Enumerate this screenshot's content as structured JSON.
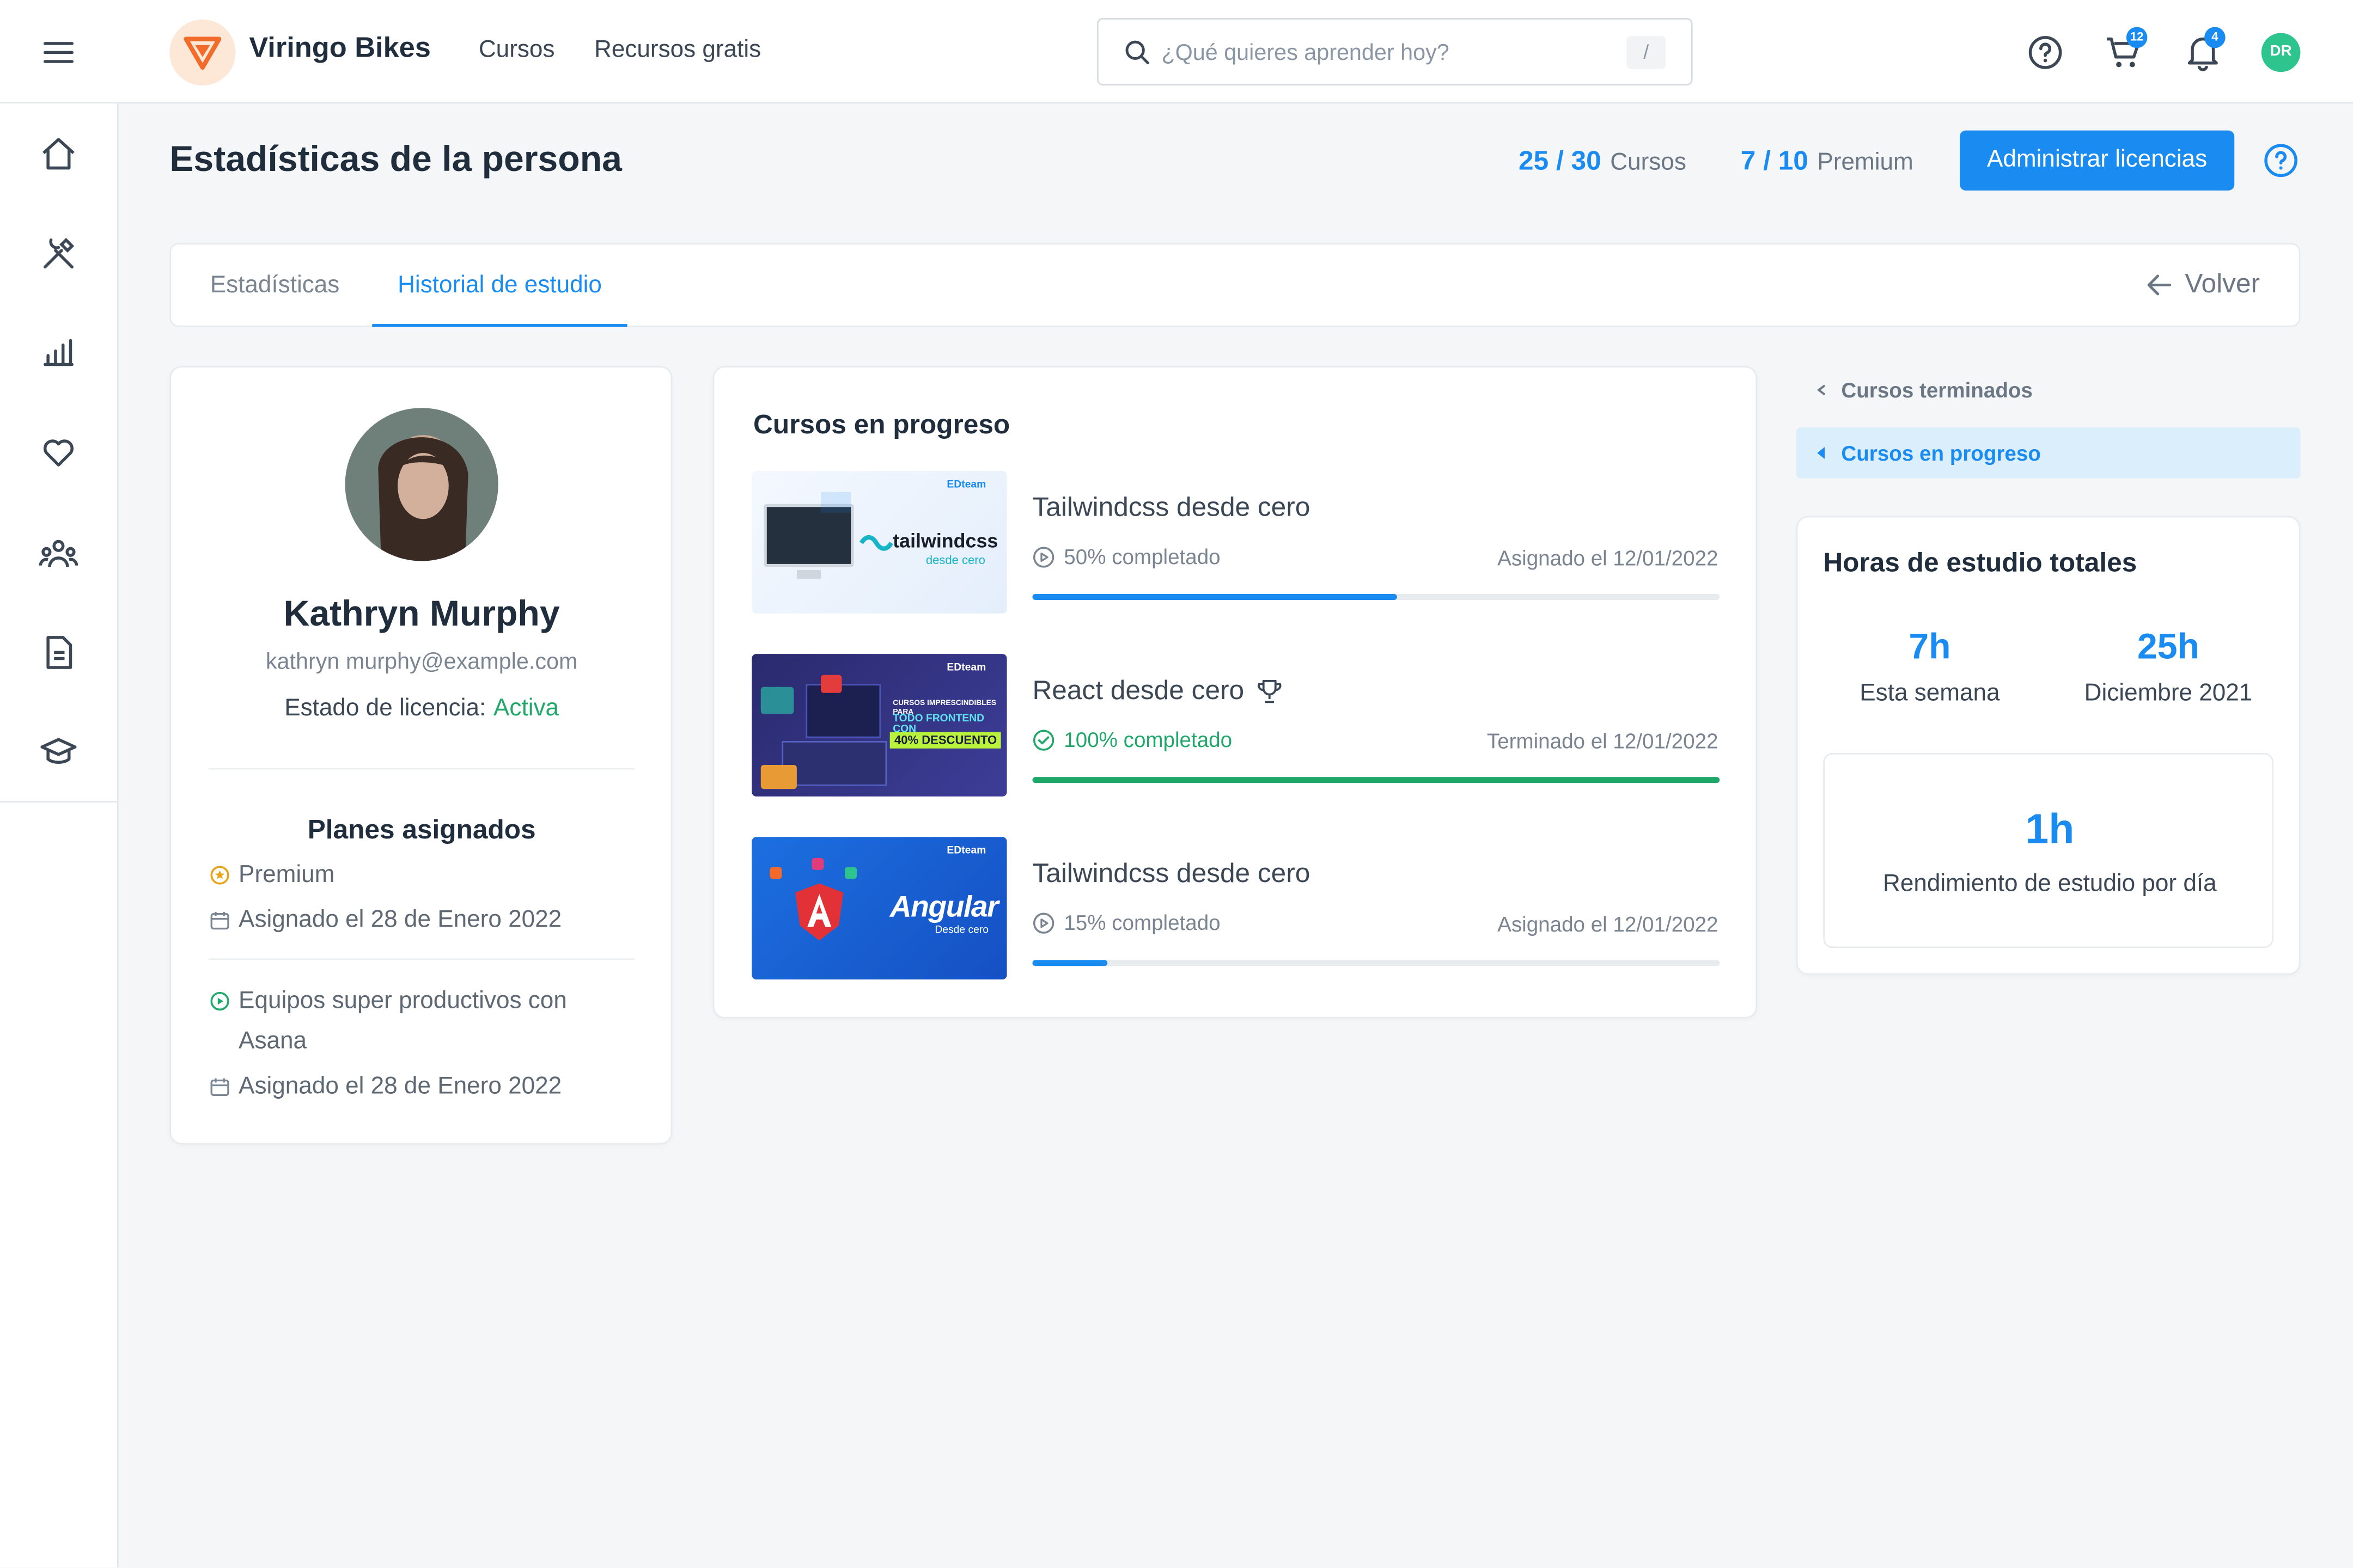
{
  "header": {
    "brand": "Viringo Bikes",
    "nav": [
      "Cursos",
      "Recursos gratis"
    ],
    "search_placeholder": "¿Qué quieres aprender hoy?",
    "search_shortcut": "/",
    "cart_count": "12",
    "notif_count": "4",
    "user_initials": "DR"
  },
  "sidebar": {
    "items": [
      "home-icon",
      "tools-icon",
      "chart-icon",
      "heart-icon",
      "team-icon",
      "document-icon",
      "graduation-cap-icon"
    ]
  },
  "page": {
    "title": "Estadísticas de la persona",
    "courses_stat": "25 / 30",
    "courses_label": "Cursos",
    "premium_stat": "7 / 10",
    "premium_label": "Premium",
    "manage_button": "Administrar licencias"
  },
  "tabs": {
    "items": [
      "Estadísticas",
      "Historial de estudio"
    ],
    "active": 1,
    "back_label": "Volver"
  },
  "profile": {
    "name": "Kathryn Murphy",
    "email": "kathryn murphy@example.com",
    "license_label": "Estado de licencia:",
    "license_value": "Activa",
    "plans_title": "Planes asignados",
    "plans": [
      {
        "name": "Premium",
        "assigned": "Asignado el 28 de Enero 2022"
      },
      {
        "name": "Equipos super productivos con Asana",
        "assigned": "Asignado el 28 de Enero 2022"
      }
    ]
  },
  "courses": {
    "title": "Cursos en progreso",
    "items": [
      {
        "title": "Tailwindcss desde cero",
        "progress": "50% completado",
        "progress_value": 0.53,
        "date": "Asignado el 12/01/2022",
        "done": false,
        "thumb_text": "tailwindcss",
        "thumb_sub": "desde cero",
        "thumb_brand": "EDteam"
      },
      {
        "title": "React desde cero",
        "progress": "100% completado",
        "progress_value": 1.0,
        "date": "Terminado el 12/01/2022",
        "done": true,
        "thumb_text": "TODO FRONTEND CON",
        "thumb_sub": "40% DESCUENTO",
        "thumb_brand": "EDteam",
        "thumb_top": "CURSOS IMPRESCINDIBLES PARA"
      },
      {
        "title": "Tailwindcss desde cero",
        "progress": "15% completado",
        "progress_value": 0.11,
        "date": "Asignado el 12/01/2022",
        "done": false,
        "thumb_text": "Angular",
        "thumb_sub": "Desde cero",
        "thumb_brand": "EDteam"
      }
    ]
  },
  "side_nav": {
    "items": [
      "Cursos terminados",
      "Cursos en progreso"
    ],
    "active": 1
  },
  "hours": {
    "title": "Horas de estudio totales",
    "week_value": "7h",
    "week_label": "Esta semana",
    "month_value": "25h",
    "month_label": "Diciembre 2021",
    "daily_value": "1h",
    "daily_label": "Rendimiento de estudio por día"
  },
  "colors": {
    "accent": "#1a8bf0",
    "success": "#1fa869",
    "brand_orange": "#f26b2a"
  }
}
